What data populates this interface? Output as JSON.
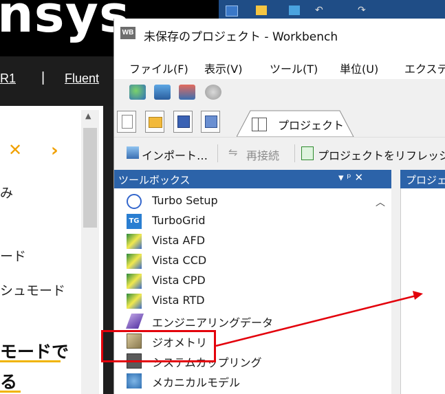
{
  "background_page": {
    "logo": "nsys",
    "nav": [
      "R1",
      "|",
      "Fluent"
    ],
    "side_texts": [
      "み",
      "ード",
      "シュモード"
    ],
    "bold_texts": [
      "モードで",
      "る"
    ]
  },
  "workbench": {
    "icon_text": "WB",
    "title": "未保存のプロジェクト - Workbench",
    "menu": [
      "ファイル(F)",
      "表示(V)",
      "ツール(T)",
      "単位(U)",
      "エクステ"
    ],
    "project_tab": "プロジェクト",
    "toolbar": {
      "import": "インポート…",
      "reconnect": "再接続",
      "refresh": "プロジェクトをリフレッシュ"
    },
    "toolbox": {
      "title": "ツールボックス",
      "controls": "▾ ᵖ ✕",
      "items": [
        {
          "label": "Turbo Setup",
          "icon": "turbo-setup-icon"
        },
        {
          "label": "TurboGrid",
          "icon": "turbogrid-icon"
        },
        {
          "label": "Vista AFD",
          "icon": "vista-icon"
        },
        {
          "label": "Vista CCD",
          "icon": "vista-icon"
        },
        {
          "label": "Vista CPD",
          "icon": "vista-icon"
        },
        {
          "label": "Vista RTD",
          "icon": "vista-icon"
        },
        {
          "label": "エンジニアリングデータ",
          "icon": "engineering-data-icon"
        },
        {
          "label": "ジオメトリ",
          "icon": "geometry-icon"
        },
        {
          "label": "システムカップリング",
          "icon": "system-coupling-icon"
        },
        {
          "label": "メカニカルモデル",
          "icon": "mechanical-model-icon"
        }
      ]
    },
    "project_pane_title": "プロジェ"
  },
  "colors": {
    "pane_header": "#2c63a9",
    "annotation_red": "#e3000b",
    "ansys_bar": "#1f4d86"
  }
}
